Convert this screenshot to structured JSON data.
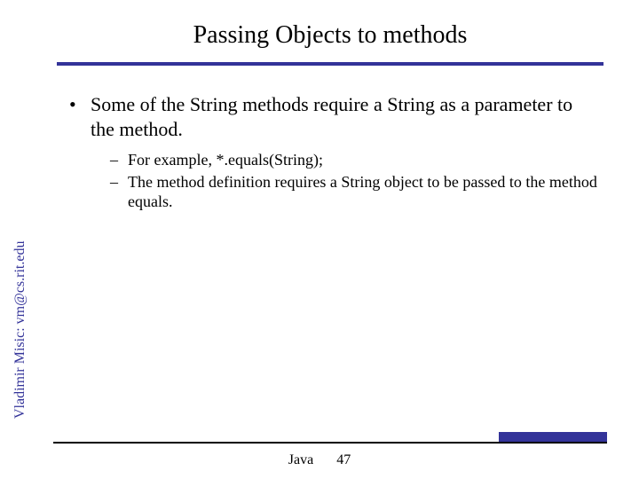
{
  "title": "Passing Objects to methods",
  "bullets": {
    "main": "Some of the String methods require a String as a parameter to the method.",
    "sub1": "For example, *.equals(String);",
    "sub2": "The method definition requires a String object to be passed to the method equals."
  },
  "sidebar": "Vladimir Misic: vm@cs.rit.edu",
  "footer": {
    "label": "Java",
    "page": "47"
  },
  "colors": {
    "accent": "#333399"
  }
}
